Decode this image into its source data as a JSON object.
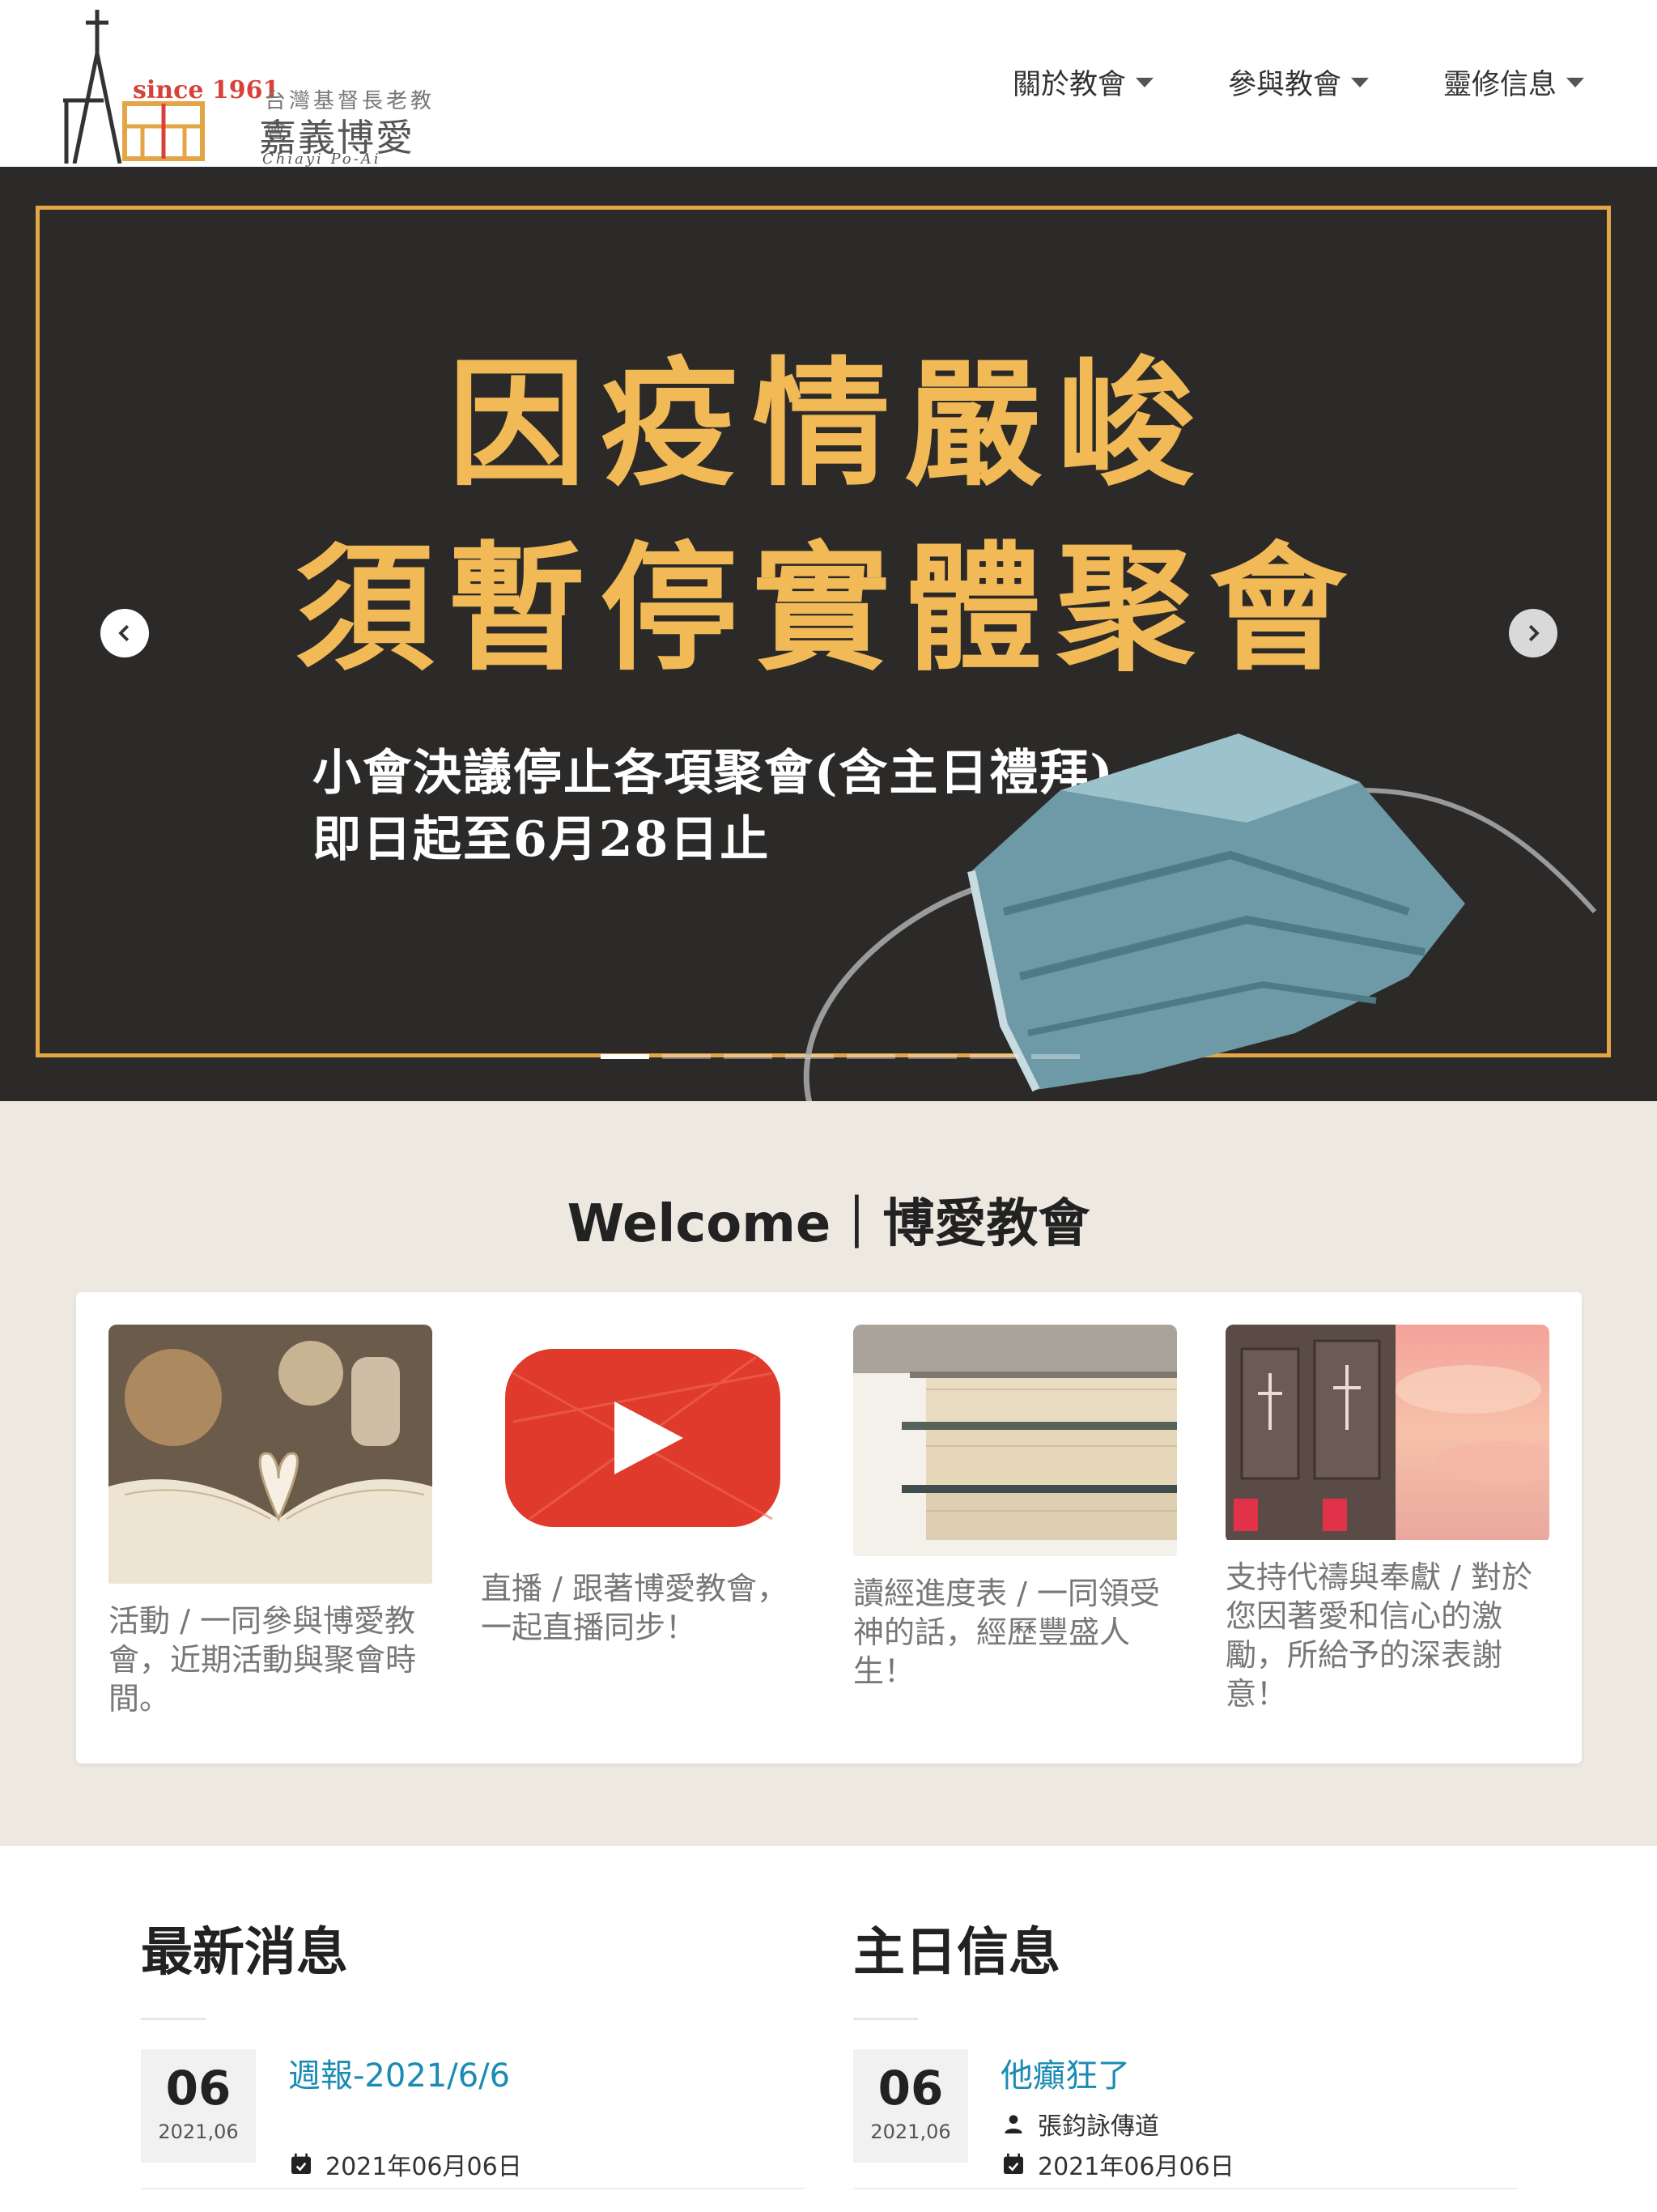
{
  "header": {
    "logo": {
      "since": "since 1961",
      "subtitle": "台灣基督長老教會",
      "name": "嘉義博愛教會",
      "name_en": "Chiayi Po-Ai Church"
    },
    "nav": [
      {
        "label": "關於教會",
        "icon": "caret-down-icon"
      },
      {
        "label": "參與教會",
        "icon": "caret-down-icon"
      },
      {
        "label": "靈修信息",
        "icon": "caret-down-icon"
      }
    ]
  },
  "hero": {
    "title_line1": "因疫情嚴峻",
    "title_line2": "須暫停實體聚會",
    "sub_line1": "小會決議停止各項聚會(含主日禮拜)",
    "sub_line2": "即日起至6月28日止",
    "slide_count": 8,
    "active_slide": 1,
    "colors": {
      "background": "#2b2a28",
      "gold": "#e3a545",
      "text": "#ffffff"
    }
  },
  "welcome": {
    "title": "Welcome｜博愛教會",
    "features": [
      {
        "image": "open-book-heart-pages",
        "text": "活動 / 一同參與博愛教會，近期活動與聚會時間。"
      },
      {
        "image": "youtube-play-icon",
        "text": "直播 / 跟著博愛教會，一起直播同步！"
      },
      {
        "image": "stack-of-books",
        "text": "讀經進度表 / 一同領受神的話，經歷豐盛人生！"
      },
      {
        "image": "church-tower-sunset",
        "text": "支持代禱與奉獻 / 對於您因著愛和信心的激勵，所給予的深表謝意！"
      }
    ]
  },
  "news": {
    "left": {
      "heading": "最新消息",
      "post": {
        "day": "06",
        "ym": "2021,06",
        "title": "週報-2021/6/6",
        "date": "2021年06月06日"
      }
    },
    "right": {
      "heading": "主日信息",
      "post": {
        "day": "06",
        "ym": "2021,06",
        "title": "他癲狂了",
        "author": "張鈞詠傳道",
        "date": "2021年06月06日"
      }
    }
  }
}
